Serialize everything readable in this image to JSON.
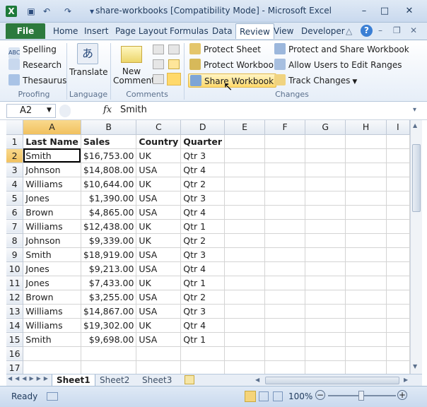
{
  "window": {
    "title": "share-workbooks  [Compatibility Mode]  -  Microsoft Excel"
  },
  "tabs": [
    "File",
    "Home",
    "Insert",
    "Page Layout",
    "Formulas",
    "Data",
    "Review",
    "View",
    "Developer"
  ],
  "ribbon": {
    "proofing": {
      "spelling": "Spelling",
      "research": "Research",
      "thesaurus": "Thesaurus",
      "label": "Proofing"
    },
    "language": {
      "translate": "Translate",
      "label": "Language"
    },
    "comments": {
      "new_comment_l1": "New",
      "new_comment_l2": "Comment",
      "label": "Comments"
    },
    "changes": {
      "protect_sheet": "Protect Sheet",
      "protect_workbook": "Protect Workbook",
      "share_workbook": "Share Workbook",
      "protect_share": "Protect and Share Workbook",
      "allow_edit": "Allow Users to Edit Ranges",
      "track_changes": "Track Changes",
      "label": "Changes"
    }
  },
  "formula_bar": {
    "name_box": "A2",
    "fx": "fx",
    "value": "Smith"
  },
  "grid": {
    "columns": [
      "A",
      "B",
      "C",
      "D",
      "E",
      "F",
      "G",
      "H",
      "I"
    ],
    "header": [
      "Last Name",
      "Sales",
      "Country",
      "Quarter"
    ],
    "rows": [
      [
        "Smith",
        "$16,753.00",
        "UK",
        "Qtr 3"
      ],
      [
        "Johnson",
        "$14,808.00",
        "USA",
        "Qtr 4"
      ],
      [
        "Williams",
        "$10,644.00",
        "UK",
        "Qtr 2"
      ],
      [
        "Jones",
        "$1,390.00",
        "USA",
        "Qtr 3"
      ],
      [
        "Brown",
        "$4,865.00",
        "USA",
        "Qtr 4"
      ],
      [
        "Williams",
        "$12,438.00",
        "UK",
        "Qtr 1"
      ],
      [
        "Johnson",
        "$9,339.00",
        "UK",
        "Qtr 2"
      ],
      [
        "Smith",
        "$18,919.00",
        "USA",
        "Qtr 3"
      ],
      [
        "Jones",
        "$9,213.00",
        "USA",
        "Qtr 4"
      ],
      [
        "Jones",
        "$7,433.00",
        "UK",
        "Qtr 1"
      ],
      [
        "Brown",
        "$3,255.00",
        "USA",
        "Qtr 2"
      ],
      [
        "Williams",
        "$14,867.00",
        "USA",
        "Qtr 3"
      ],
      [
        "Williams",
        "$19,302.00",
        "UK",
        "Qtr 4"
      ],
      [
        "Smith",
        "$9,698.00",
        "USA",
        "Qtr 1"
      ]
    ],
    "row_numbers": [
      "1",
      "2",
      "3",
      "4",
      "5",
      "6",
      "7",
      "8",
      "9",
      "10",
      "11",
      "12",
      "13",
      "14",
      "15",
      "16",
      "17"
    ]
  },
  "sheets": [
    "Sheet1",
    "Sheet2",
    "Sheet3"
  ],
  "status": {
    "ready": "Ready",
    "zoom": "100%"
  },
  "colors": {
    "file_tab": "#2c7a3d",
    "selected_header": "#f1c15f",
    "ribbon_bg": "#e6eef8"
  }
}
